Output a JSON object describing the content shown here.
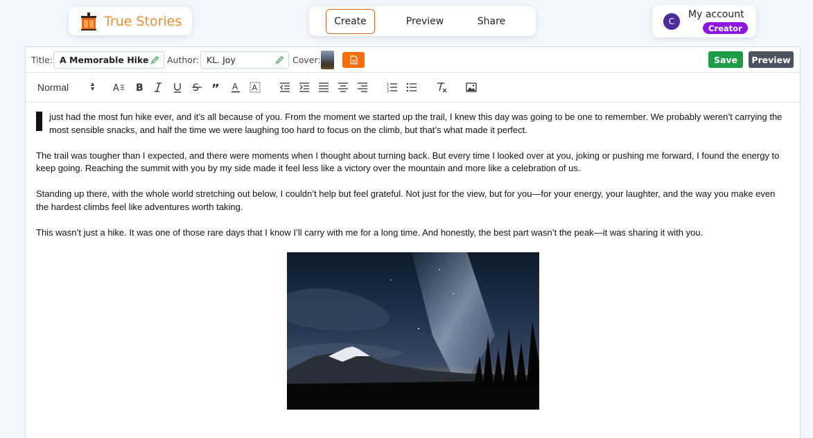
{
  "brand": {
    "name": "True Stories",
    "logo_icon": "lantern-icon",
    "color": "#e8913a"
  },
  "nav": {
    "tabs": [
      {
        "label": "Create",
        "active": true
      },
      {
        "label": "Preview",
        "active": false
      },
      {
        "label": "Share",
        "active": false
      }
    ]
  },
  "account": {
    "avatar_initial": "C",
    "label": "My account",
    "role": "Creator"
  },
  "meta": {
    "title_label": "Title:",
    "title_value": "A Memorable Hike",
    "author_label": "Author:",
    "author_value": "KL. Joy",
    "cover_label": "Cover:",
    "save_label": "Save",
    "preview_label": "Preview"
  },
  "toolbar": {
    "format_value": "Normal",
    "icons": [
      "font-size-icon",
      "bold-icon",
      "italic-icon",
      "underline-icon",
      "strikethrough-icon",
      "blockquote-icon",
      "text-color-icon",
      "highlight-icon",
      "outdent-icon",
      "indent-icon",
      "align-left-icon",
      "align-center-icon",
      "align-right-icon",
      "ordered-list-icon",
      "bullet-list-icon",
      "clear-format-icon",
      "insert-image-icon"
    ]
  },
  "content": {
    "dropcap": "I",
    "paragraphs": [
      "just had the most fun hike ever, and it’s all because of you. From the moment we started up the trail, I knew this day was going to be one to remember. We probably weren’t carrying the most sensible snacks, and half the time we were laughing too hard to focus on the climb, but that’s what made it perfect.",
      "The trail was tougher than I expected, and there were moments when I thought about turning back. But every time I looked over at you, joking or pushing me forward, I found the energy to keep going. Reaching the summit with you by my side made it feel less like a victory over the mountain and more like a celebration of us.",
      "Standing up there, with the whole world stretching out below, I couldn’t help but feel grateful. Not just for the view, but for you—for your energy, your laughter, and the way you make even the hardest climbs feel like adventures worth taking.",
      "This wasn’t just a hike. It was one of those rare days that I know I’ll carry with me for a long time. And honestly, the best part wasn’t the peak—it was sharing it with you."
    ]
  },
  "colors": {
    "accent_orange": "#f56e0c",
    "save_green": "#1e9d47",
    "preview_gray": "#4a535e",
    "creator_purple": "#8d17e0",
    "avatar_purple": "#4c2b9a"
  }
}
